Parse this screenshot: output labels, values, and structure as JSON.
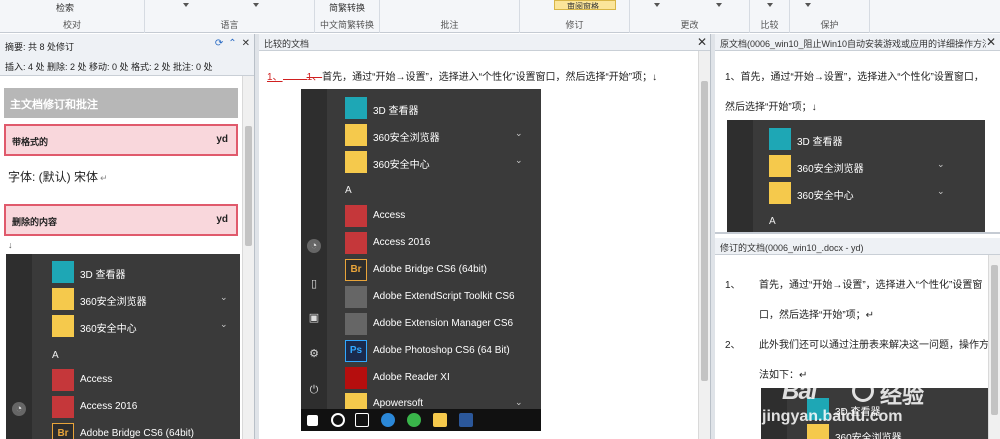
{
  "ribbon": {
    "proofing_top": "检索",
    "groups": [
      "校对",
      "语言",
      "中文简繁转换",
      "批注",
      "修订",
      "更改",
      "比较",
      "保护"
    ],
    "conversion_top": "简繁转换",
    "review_button": "审阅窗格"
  },
  "summary": {
    "line1": "摘要: 共 8 处修订",
    "line2": "插入: 4 处 删除: 2 处 移动: 0 处 格式: 2 处 批注: 0 处"
  },
  "left": {
    "section_title": "主文档修订和批注",
    "rev1_label": "带格式的",
    "rev1_author": "yd",
    "font_line": "字体: (默认) 宋体",
    "rev2_label": "删除的内容",
    "rev2_author": "yd",
    "para_mark": "↵",
    "small_mark": "↓"
  },
  "mid": {
    "title": "比较的文档",
    "ins": "1、",
    "del": "1、",
    "text": "首先，通过“开始→设置”，选择进入“个性化”设置窗口，然后选择“开始”项；↓"
  },
  "right_top": {
    "title": "原文档(0006_win10_阻止Win10自动安装游戏或应用的详细操作方法",
    "line1": "1、首先，通过“开始→设置”，选择进入“个性化”设置窗口，",
    "line2": "然后选择“开始”项；↓"
  },
  "right_bottom": {
    "title": "修订的文档(0006_win10_.docx - yd)",
    "n1": "1、",
    "l1a": "首先，通过“开始→设置”，选择进入“个性化”设置窗",
    "l1b": "口，然后选择“开始”项；↵",
    "n2": "2、",
    "l2a": "此外我们还可以通过注册表来解决这一问题，操作方",
    "l2b": "法如下：↵"
  },
  "menu": {
    "apps": {
      "viewer3d": "3D 查看器",
      "browser360": "360安全浏览器",
      "center360": "360安全中心",
      "letter_a": "A",
      "access": "Access",
      "access2016": "Access 2016",
      "bridge": "Adobe Bridge CS6 (64bit)",
      "extendscript": "Adobe ExtendScript Toolkit CS6",
      "extmanager": "Adobe Extension Manager CS6",
      "photoshop": "Adobe Photoshop CS6 (64 Bit)",
      "reader": "Adobe Reader XI",
      "apowersoft": "Apowersoft"
    },
    "tile_br": "Br",
    "tile_ps": "Ps"
  },
  "watermark": {
    "brand": "Bai",
    "cn": "经验",
    "url": "jingyan.baidu.com"
  }
}
